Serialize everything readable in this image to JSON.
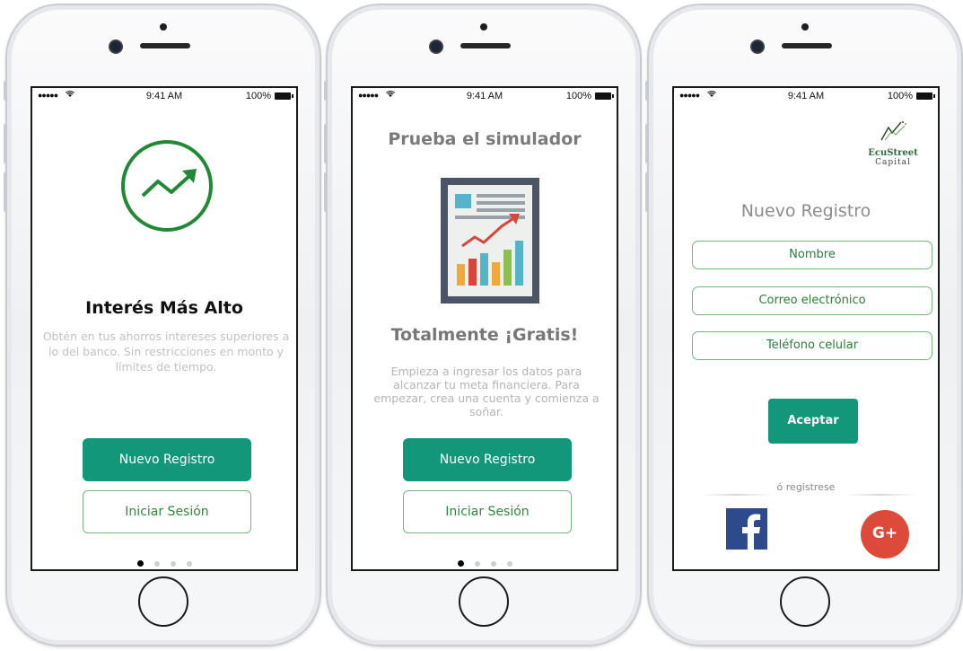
{
  "status_bar": {
    "signal": "●●●●●",
    "wifi": "wifi-icon",
    "time": "9:41 AM",
    "battery": "100%"
  },
  "screen1": {
    "title": "Interés Más Alto",
    "description": "Obtén en tus ahorros intereses superiores a lo del banco. Sin restricciones en monto y límites de tiempo.",
    "primary_button": "Nuevo Registro",
    "secondary_button": "Iniciar Sesión",
    "page_indicator": {
      "total": 4,
      "active": 1
    }
  },
  "screen2": {
    "heading": "Prueba el simulador",
    "title": "Totalmente ¡Gratis!",
    "description": "Empieza a ingresar los datos para alcanzar tu meta financiera. Para empezar, crea una cuenta y comienza a soñar.",
    "primary_button": "Nuevo Registro",
    "secondary_button": "Iniciar Sesión",
    "page_indicator": {
      "total": 4,
      "active": 1
    }
  },
  "screen3": {
    "logo": {
      "name": "EcuStreet",
      "sub": "Capital"
    },
    "title": "Nuevo Registro",
    "fields": {
      "name": "Nombre",
      "email": "Correo electrónico",
      "phone": "Teléfono celular"
    },
    "accept_button": "Aceptar",
    "or_text": "ó registrese",
    "facebook": "f",
    "google": "G+"
  },
  "colors": {
    "accent": "#12977a",
    "green_icon": "#1f8a33",
    "outline": "#74b87c",
    "facebook": "#2d4a8c",
    "google": "#de4a3a"
  }
}
